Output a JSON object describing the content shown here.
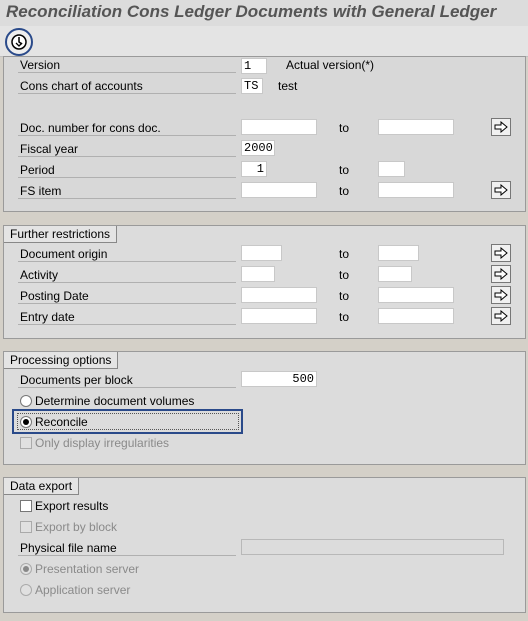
{
  "window": {
    "title": "Reconciliation Cons Ledger Documents with General Ledger"
  },
  "toolbar": {
    "execute_icon": "execute-clock-icon"
  },
  "main": {
    "version_label": "Version",
    "version_value": "1",
    "version_text": "Actual version(*)",
    "coa_label": "Cons chart of accounts",
    "coa_value": "TS",
    "coa_text": "test",
    "docnum_label": "Doc. number for cons doc.",
    "docnum_from": "",
    "docnum_to": "",
    "fiscal_label": "Fiscal year",
    "fiscal_value": "2000",
    "period_label": "Period",
    "period_from": "1",
    "period_to": "",
    "fsitem_label": "FS item",
    "fsitem_from": "",
    "fsitem_to": "",
    "to_label": "to"
  },
  "further": {
    "title": "Further restrictions",
    "rows": [
      {
        "label": "Document origin",
        "from": "",
        "to": ""
      },
      {
        "label": "Activity",
        "from": "",
        "to": ""
      },
      {
        "label": "Posting Date",
        "from": "",
        "to": ""
      },
      {
        "label": "Entry date",
        "from": "",
        "to": ""
      }
    ]
  },
  "processing": {
    "title": "Processing options",
    "docs_per_block_label": "Documents per block",
    "docs_per_block_value": "500",
    "radio_volumes": "Determine document volumes",
    "radio_reconcile": "Reconcile",
    "selected": "Reconcile",
    "only_irregularities": "Only display irregularities"
  },
  "export": {
    "title": "Data export",
    "export_results": "Export results",
    "export_by_block": "Export by block",
    "file_name_label": "Physical file name",
    "file_name_value": "",
    "radio_presentation": "Presentation server",
    "radio_application": "Application server",
    "selected_server": "Presentation server"
  },
  "colors": {
    "focus": "#2a4a8a",
    "background": "#d4d0c8"
  }
}
